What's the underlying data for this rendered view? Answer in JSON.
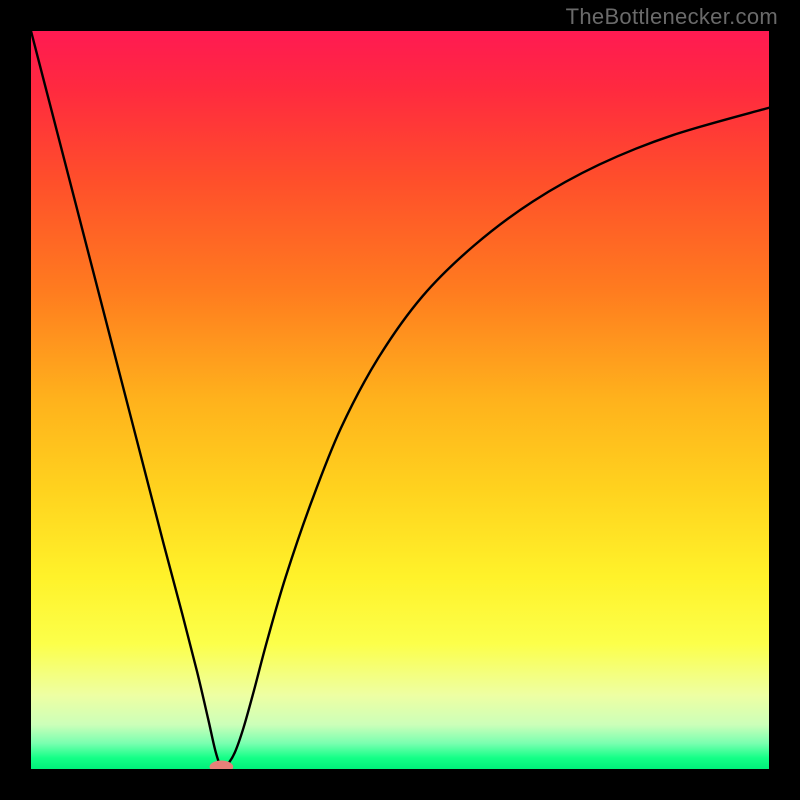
{
  "watermark": "TheBottlenecker.com",
  "chart_data": {
    "type": "line",
    "title": "",
    "xlabel": "",
    "ylabel": "",
    "xlim": [
      0,
      100
    ],
    "ylim": [
      0,
      100
    ],
    "gradient_stops": [
      {
        "offset": 0.0,
        "color": "#ff1a52"
      },
      {
        "offset": 0.08,
        "color": "#ff2a3f"
      },
      {
        "offset": 0.2,
        "color": "#ff4e2b"
      },
      {
        "offset": 0.35,
        "color": "#ff7b1f"
      },
      {
        "offset": 0.5,
        "color": "#ffb21c"
      },
      {
        "offset": 0.62,
        "color": "#ffd21e"
      },
      {
        "offset": 0.74,
        "color": "#fff22a"
      },
      {
        "offset": 0.83,
        "color": "#fcff4a"
      },
      {
        "offset": 0.9,
        "color": "#eeffa3"
      },
      {
        "offset": 0.94,
        "color": "#ccffb9"
      },
      {
        "offset": 0.965,
        "color": "#7affb0"
      },
      {
        "offset": 0.985,
        "color": "#14ff87"
      },
      {
        "offset": 1.0,
        "color": "#00f07a"
      }
    ],
    "curve": {
      "x": [
        0.0,
        3,
        6,
        9,
        12,
        15,
        18,
        20.5,
        22.5,
        24,
        25.0,
        25.8,
        26.6,
        27.6,
        28.8,
        30.2,
        32,
        34.5,
        38,
        42,
        47,
        53,
        60,
        68,
        77,
        87,
        100
      ],
      "y": [
        100,
        88.4,
        76.8,
        65.2,
        53.6,
        42.0,
        30.4,
        21.0,
        13.2,
        6.8,
        2.4,
        0.2,
        0.6,
        2.2,
        5.6,
        10.6,
        17.4,
        26.0,
        36.2,
        46.2,
        55.6,
        64.0,
        70.9,
        76.9,
        81.9,
        85.9,
        89.6
      ]
    },
    "marker": {
      "x": 25.8,
      "y": 0.3,
      "rx": 1.6,
      "ry": 0.85,
      "color": "#e88079"
    }
  }
}
